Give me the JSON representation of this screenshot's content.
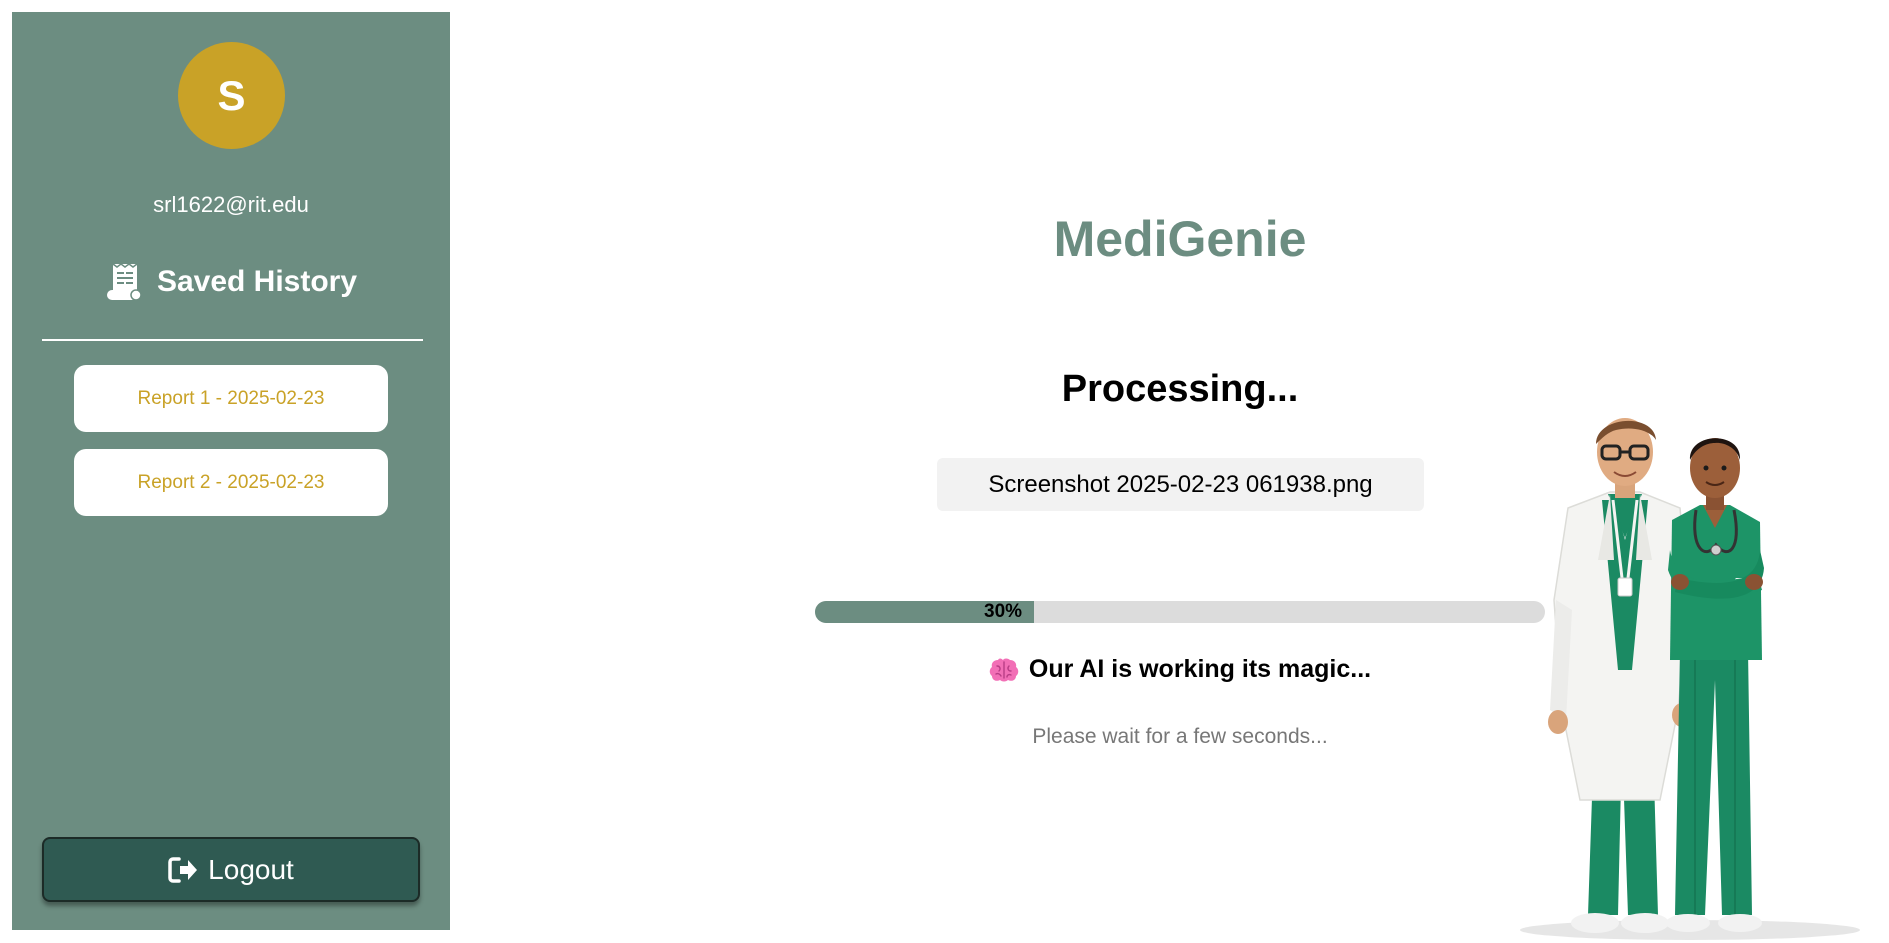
{
  "sidebar": {
    "avatar_letter": "S",
    "user_email": "srl1622@rit.edu",
    "history_icon": "receipt-scroll-icon",
    "history_title": "Saved History",
    "reports": [
      {
        "label": "Report 1 - 2025-02-23"
      },
      {
        "label": "Report 2 - 2025-02-23"
      }
    ],
    "logout_icon": "sign-out-icon",
    "logout_label": "Logout"
  },
  "main": {
    "app_title": "MediGenie",
    "status_title": "Processing...",
    "file_name": "Screenshot 2025-02-23 061938.png",
    "progress": {
      "percent": 30,
      "label": "30%"
    },
    "magic_icon": "brain-icon",
    "magic_text": "Our AI is working its magic...",
    "wait_text": "Please wait for a few seconds..."
  },
  "colors": {
    "sidebar_bg": "#6c8d81",
    "accent_gold": "#c9a227",
    "logout_bg": "#2f5a52",
    "title_green": "#6c8d81",
    "scrub_green": "#1b8a63"
  }
}
